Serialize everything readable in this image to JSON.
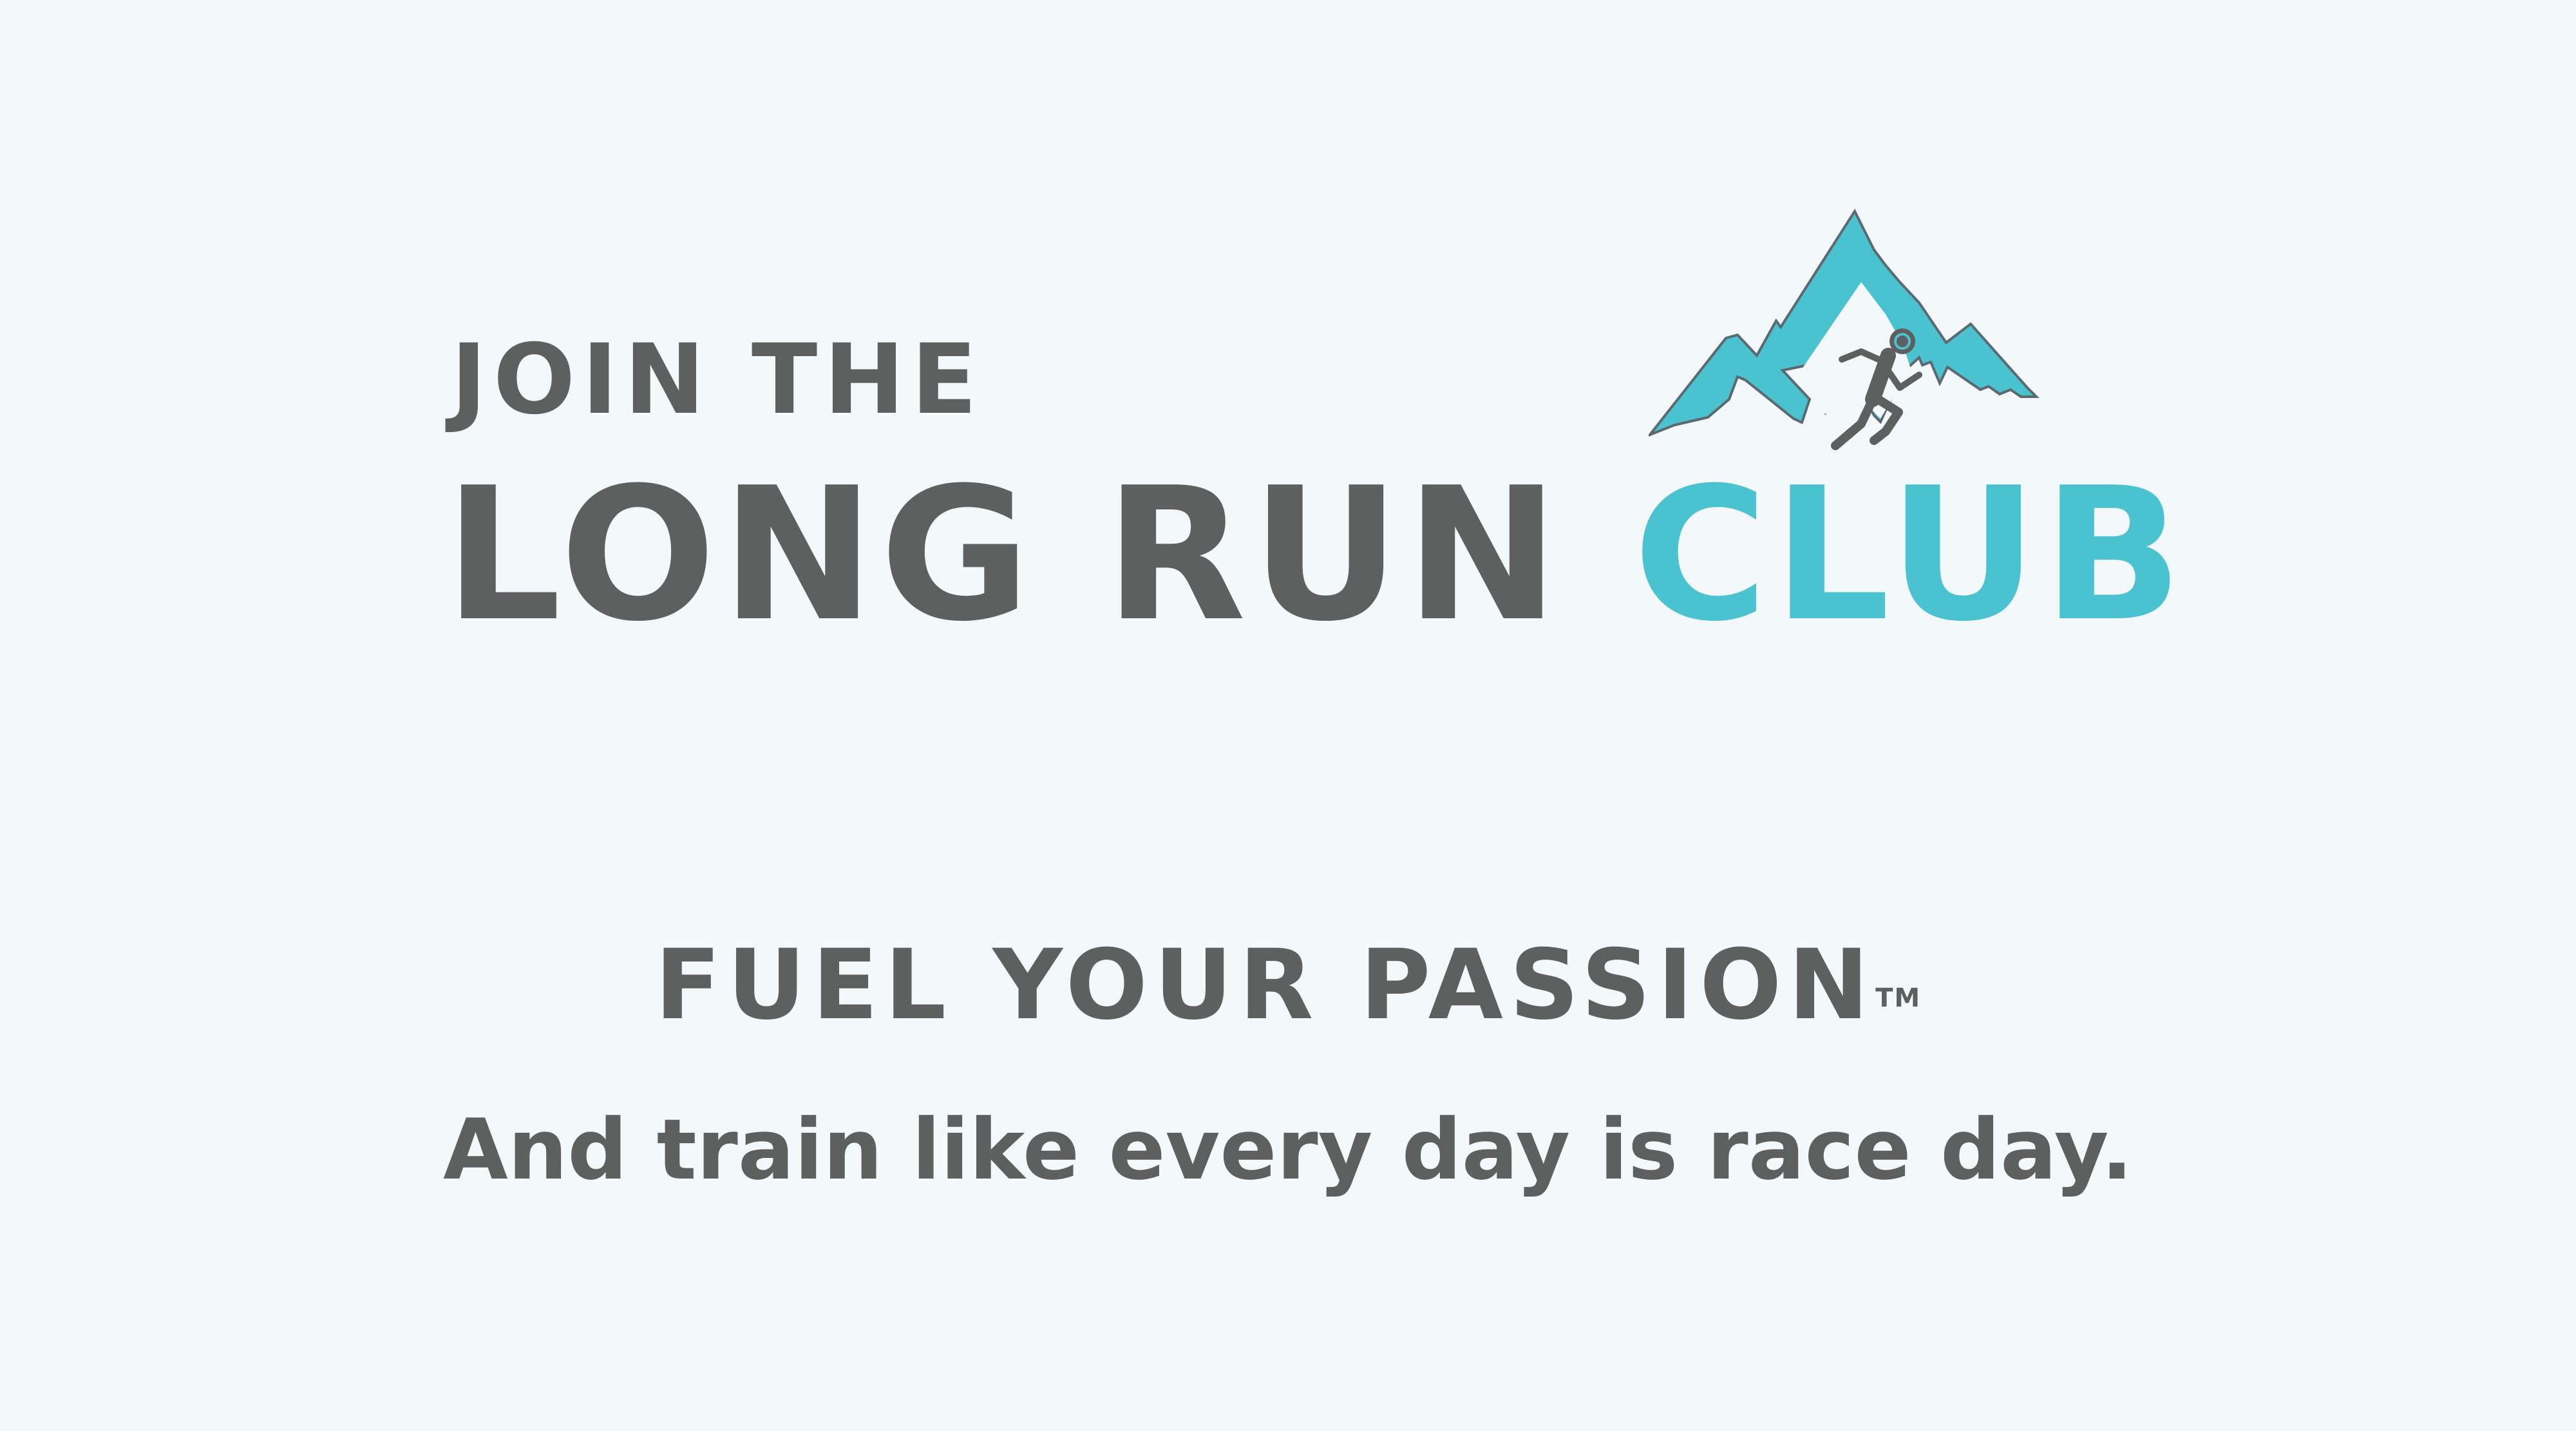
{
  "header": {
    "pre_title": "JOIN THE",
    "title_main": "LONG RUN",
    "title_accent": "CLUB"
  },
  "logo": {
    "icon": "mountain-runner-icon",
    "colors": {
      "mountain": "#4ac2d0",
      "runner": "#5e605f"
    }
  },
  "tagline": {
    "text": "FUEL YOUR PASSION",
    "mark": "TM"
  },
  "subline": {
    "text": "And train like every day is race day."
  },
  "colors": {
    "background": "#f3f8fb",
    "text": "#5e605f",
    "accent": "#4ac2d0"
  }
}
